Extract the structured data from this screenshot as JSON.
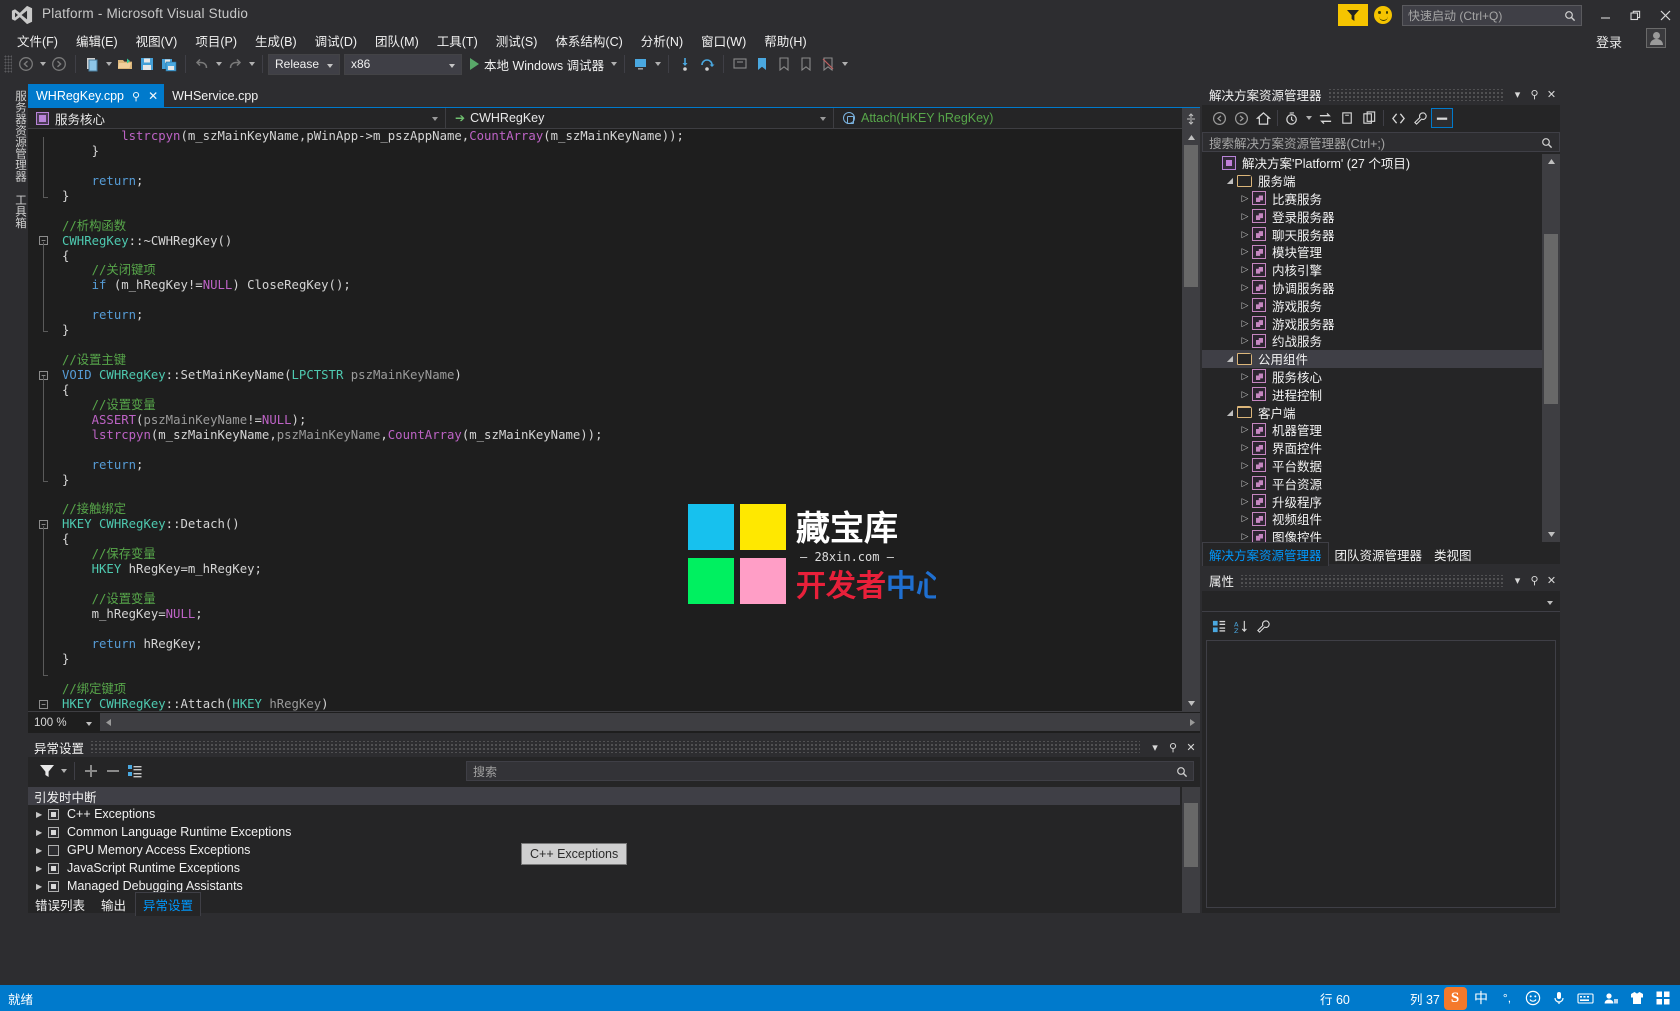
{
  "window": {
    "title": "Platform - Microsoft Visual Studio",
    "signin": "登录",
    "quick_launch_placeholder": "快速启动 (Ctrl+Q)",
    "minimize": "—",
    "restore": "❐",
    "close": "✕"
  },
  "menu": [
    {
      "label": "文件(F)"
    },
    {
      "label": "编辑(E)"
    },
    {
      "label": "视图(V)"
    },
    {
      "label": "项目(P)"
    },
    {
      "label": "生成(B)"
    },
    {
      "label": "调试(D)"
    },
    {
      "label": "团队(M)"
    },
    {
      "label": "工具(T)"
    },
    {
      "label": "测试(S)"
    },
    {
      "label": "体系结构(C)"
    },
    {
      "label": "分析(N)"
    },
    {
      "label": "窗口(W)"
    },
    {
      "label": "帮助(H)"
    }
  ],
  "toolbar": {
    "configuration": "Release",
    "platform": "x86",
    "debug_target": "本地 Windows 调试器"
  },
  "left_dock": {
    "tabs": [
      "服务器资源管理器",
      "工具箱"
    ]
  },
  "editor": {
    "tabs": [
      {
        "label": "WHRegKey.cpp",
        "active": true,
        "pin": "⚲",
        "close": "✕"
      },
      {
        "label": "WHService.cpp",
        "active": false
      }
    ],
    "navbar": {
      "project": "服务核心",
      "class": "CWHRegKey",
      "member": "Attach(HKEY hRegKey)"
    },
    "zoom": "100 %",
    "code_lines": [
      {
        "indent": 0,
        "tokens": [
          {
            "t": "        lstrcpyn",
            "c": "m"
          },
          {
            "t": "(m_szMainKeyName,pWinApp->m_pszAppName,",
            "c": "p"
          },
          {
            "t": "CountArray",
            "c": "m"
          },
          {
            "t": "(m_szMainKeyName));",
            "c": "p"
          }
        ]
      },
      {
        "indent": 0,
        "tokens": [
          {
            "t": "    }",
            "c": "p"
          }
        ]
      },
      {
        "indent": 0,
        "tokens": [
          {
            "t": "",
            "c": "p"
          }
        ]
      },
      {
        "indent": 0,
        "tokens": [
          {
            "t": "    ",
            "c": "p"
          },
          {
            "t": "return",
            "c": "k"
          },
          {
            "t": ";",
            "c": "p"
          }
        ]
      },
      {
        "indent": 0,
        "tokens": [
          {
            "t": "}",
            "c": "p"
          }
        ]
      },
      {
        "indent": 0,
        "tokens": [
          {
            "t": "",
            "c": "p"
          }
        ]
      },
      {
        "indent": 0,
        "tokens": [
          {
            "t": "//析构函数",
            "c": "c"
          }
        ]
      },
      {
        "indent": 0,
        "tokens": [
          {
            "t": "CWHRegKey",
            "c": "t"
          },
          {
            "t": "::~CWHRegKey()",
            "c": "p"
          }
        ]
      },
      {
        "indent": 0,
        "tokens": [
          {
            "t": "{",
            "c": "p"
          }
        ]
      },
      {
        "indent": 0,
        "tokens": [
          {
            "t": "    ",
            "c": "p"
          },
          {
            "t": "//关闭键项",
            "c": "c"
          }
        ]
      },
      {
        "indent": 0,
        "tokens": [
          {
            "t": "    ",
            "c": "p"
          },
          {
            "t": "if",
            "c": "k"
          },
          {
            "t": " (m_hRegKey!=",
            "c": "p"
          },
          {
            "t": "NULL",
            "c": "m"
          },
          {
            "t": ") CloseRegKey();",
            "c": "p"
          }
        ]
      },
      {
        "indent": 0,
        "tokens": [
          {
            "t": "",
            "c": "p"
          }
        ]
      },
      {
        "indent": 0,
        "tokens": [
          {
            "t": "    ",
            "c": "p"
          },
          {
            "t": "return",
            "c": "k"
          },
          {
            "t": ";",
            "c": "p"
          }
        ]
      },
      {
        "indent": 0,
        "tokens": [
          {
            "t": "}",
            "c": "p"
          }
        ]
      },
      {
        "indent": 0,
        "tokens": [
          {
            "t": "",
            "c": "p"
          }
        ]
      },
      {
        "indent": 0,
        "tokens": [
          {
            "t": "//设置主键",
            "c": "c"
          }
        ]
      },
      {
        "indent": 0,
        "tokens": [
          {
            "t": "VOID",
            "c": "k"
          },
          {
            "t": " ",
            "c": "p"
          },
          {
            "t": "CWHRegKey",
            "c": "t"
          },
          {
            "t": "::SetMainKeyName(",
            "c": "p"
          },
          {
            "t": "LPCTSTR",
            "c": "t"
          },
          {
            "t": " ",
            "c": "p"
          },
          {
            "t": "pszMainKeyName",
            "c": "g"
          },
          {
            "t": ")",
            "c": "p"
          }
        ]
      },
      {
        "indent": 0,
        "tokens": [
          {
            "t": "{",
            "c": "p"
          }
        ]
      },
      {
        "indent": 0,
        "tokens": [
          {
            "t": "    ",
            "c": "p"
          },
          {
            "t": "//设置变量",
            "c": "c"
          }
        ]
      },
      {
        "indent": 0,
        "tokens": [
          {
            "t": "    ",
            "c": "p"
          },
          {
            "t": "ASSERT",
            "c": "m"
          },
          {
            "t": "(",
            "c": "p"
          },
          {
            "t": "pszMainKeyName",
            "c": "g"
          },
          {
            "t": "!=",
            "c": "p"
          },
          {
            "t": "NULL",
            "c": "m"
          },
          {
            "t": ");",
            "c": "p"
          }
        ]
      },
      {
        "indent": 0,
        "tokens": [
          {
            "t": "    ",
            "c": "p"
          },
          {
            "t": "lstrcpyn",
            "c": "m"
          },
          {
            "t": "(m_szMainKeyName,",
            "c": "p"
          },
          {
            "t": "pszMainKeyName",
            "c": "g"
          },
          {
            "t": ",",
            "c": "p"
          },
          {
            "t": "CountArray",
            "c": "m"
          },
          {
            "t": "(m_szMainKeyName));",
            "c": "p"
          }
        ]
      },
      {
        "indent": 0,
        "tokens": [
          {
            "t": "",
            "c": "p"
          }
        ]
      },
      {
        "indent": 0,
        "tokens": [
          {
            "t": "    ",
            "c": "p"
          },
          {
            "t": "return",
            "c": "k"
          },
          {
            "t": ";",
            "c": "p"
          }
        ]
      },
      {
        "indent": 0,
        "tokens": [
          {
            "t": "}",
            "c": "p"
          }
        ]
      },
      {
        "indent": 0,
        "tokens": [
          {
            "t": "",
            "c": "p"
          }
        ]
      },
      {
        "indent": 0,
        "tokens": [
          {
            "t": "//接触绑定",
            "c": "c"
          }
        ]
      },
      {
        "indent": 0,
        "tokens": [
          {
            "t": "HKEY",
            "c": "t"
          },
          {
            "t": " ",
            "c": "p"
          },
          {
            "t": "CWHRegKey",
            "c": "t"
          },
          {
            "t": "::Detach()",
            "c": "p"
          }
        ]
      },
      {
        "indent": 0,
        "tokens": [
          {
            "t": "{",
            "c": "p"
          }
        ]
      },
      {
        "indent": 0,
        "tokens": [
          {
            "t": "    ",
            "c": "p"
          },
          {
            "t": "//保存变量",
            "c": "c"
          }
        ]
      },
      {
        "indent": 0,
        "tokens": [
          {
            "t": "    ",
            "c": "p"
          },
          {
            "t": "HKEY",
            "c": "t"
          },
          {
            "t": " hRegKey=m_hRegKey;",
            "c": "p"
          }
        ]
      },
      {
        "indent": 0,
        "tokens": [
          {
            "t": "",
            "c": "p"
          }
        ]
      },
      {
        "indent": 0,
        "tokens": [
          {
            "t": "    ",
            "c": "p"
          },
          {
            "t": "//设置变量",
            "c": "c"
          }
        ]
      },
      {
        "indent": 0,
        "tokens": [
          {
            "t": "    m_hRegKey=",
            "c": "p"
          },
          {
            "t": "NULL",
            "c": "m"
          },
          {
            "t": ";",
            "c": "p"
          }
        ]
      },
      {
        "indent": 0,
        "tokens": [
          {
            "t": "",
            "c": "p"
          }
        ]
      },
      {
        "indent": 0,
        "tokens": [
          {
            "t": "    ",
            "c": "p"
          },
          {
            "t": "return",
            "c": "k"
          },
          {
            "t": " hRegKey;",
            "c": "p"
          }
        ]
      },
      {
        "indent": 0,
        "tokens": [
          {
            "t": "}",
            "c": "p"
          }
        ]
      },
      {
        "indent": 0,
        "tokens": [
          {
            "t": "",
            "c": "p"
          }
        ]
      },
      {
        "indent": 0,
        "tokens": [
          {
            "t": "//绑定键项",
            "c": "c"
          }
        ]
      },
      {
        "indent": 0,
        "tokens": [
          {
            "t": "HKEY",
            "c": "t"
          },
          {
            "t": " ",
            "c": "p"
          },
          {
            "t": "CWHRegKey",
            "c": "t"
          },
          {
            "t": "::Attach(",
            "c": "p"
          },
          {
            "t": "HKEY",
            "c": "t"
          },
          {
            "t": " ",
            "c": "p"
          },
          {
            "t": "hRegKey",
            "c": "g"
          },
          {
            "t": ")",
            "c": "p"
          }
        ]
      }
    ]
  },
  "exceptions_panel": {
    "title": "异常设置",
    "search_placeholder": "搜索",
    "column_header": "引发时中断",
    "rows": [
      {
        "label": "C++ Exceptions",
        "checked": "partial"
      },
      {
        "label": "Common Language Runtime Exceptions",
        "checked": "partial"
      },
      {
        "label": "GPU Memory Access Exceptions",
        "checked": "none"
      },
      {
        "label": "JavaScript Runtime Exceptions",
        "checked": "partial"
      },
      {
        "label": "Managed Debugging Assistants",
        "checked": "partial"
      }
    ],
    "tooltip": "C++ Exceptions"
  },
  "bottom_tabs": [
    {
      "label": "错误列表",
      "active": false
    },
    {
      "label": "输出",
      "active": false
    },
    {
      "label": "异常设置",
      "active": true
    }
  ],
  "solution_explorer": {
    "title": "解决方案资源管理器",
    "search_placeholder": "搜索解决方案资源管理器(Ctrl+;)",
    "tree": [
      {
        "label": "解决方案'Platform' (27 个项目)",
        "depth": 0,
        "kind": "solution",
        "expander": "none"
      },
      {
        "label": "服务端",
        "depth": 1,
        "kind": "folder",
        "expander": "open"
      },
      {
        "label": "比赛服务",
        "depth": 2,
        "kind": "project",
        "expander": "shut"
      },
      {
        "label": "登录服务器",
        "depth": 2,
        "kind": "project",
        "expander": "shut"
      },
      {
        "label": "聊天服务器",
        "depth": 2,
        "kind": "project",
        "expander": "shut"
      },
      {
        "label": "模块管理",
        "depth": 2,
        "kind": "project",
        "expander": "shut"
      },
      {
        "label": "内核引擎",
        "depth": 2,
        "kind": "project",
        "expander": "shut"
      },
      {
        "label": "协调服务器",
        "depth": 2,
        "kind": "project",
        "expander": "shut"
      },
      {
        "label": "游戏服务",
        "depth": 2,
        "kind": "project",
        "expander": "shut"
      },
      {
        "label": "游戏服务器",
        "depth": 2,
        "kind": "project",
        "expander": "shut"
      },
      {
        "label": "约战服务",
        "depth": 2,
        "kind": "project",
        "expander": "shut"
      },
      {
        "label": "公用组件",
        "depth": 1,
        "kind": "folder",
        "expander": "open",
        "selected": true
      },
      {
        "label": "服务核心",
        "depth": 2,
        "kind": "project",
        "expander": "shut"
      },
      {
        "label": "进程控制",
        "depth": 2,
        "kind": "project",
        "expander": "shut"
      },
      {
        "label": "客户端",
        "depth": 1,
        "kind": "folder",
        "expander": "open"
      },
      {
        "label": "机器管理",
        "depth": 2,
        "kind": "project",
        "expander": "shut"
      },
      {
        "label": "界面控件",
        "depth": 2,
        "kind": "project",
        "expander": "shut"
      },
      {
        "label": "平台数据",
        "depth": 2,
        "kind": "project",
        "expander": "shut"
      },
      {
        "label": "平台资源",
        "depth": 2,
        "kind": "project",
        "expander": "shut"
      },
      {
        "label": "升级程序",
        "depth": 2,
        "kind": "project",
        "expander": "shut"
      },
      {
        "label": "视频组件",
        "depth": 2,
        "kind": "project",
        "expander": "shut"
      },
      {
        "label": "图像控件",
        "depth": 2,
        "kind": "project",
        "expander": "shut"
      }
    ],
    "tabs": [
      {
        "label": "解决方案资源管理器",
        "active": true
      },
      {
        "label": "团队资源管理器",
        "active": false
      },
      {
        "label": "类视图",
        "active": false
      }
    ]
  },
  "properties_panel": {
    "title": "属性"
  },
  "status_bar": {
    "state": "就绪",
    "line": "行 60",
    "column": "列 37",
    "ime_mode": "中",
    "sogou": "S"
  },
  "watermark": {
    "title": "藏宝库",
    "url": "28xin.com",
    "subtitle": "开发者中心",
    "colors": [
      "#17c1ee",
      "#ffe800",
      "#00f060",
      "#ff9ec6"
    ]
  },
  "colors": {
    "accent": "#007acc",
    "chrome": "#2d2d30",
    "panel": "#252526",
    "editor_bg": "#1e1e1e",
    "feedback_yellow": "#f5c400"
  }
}
